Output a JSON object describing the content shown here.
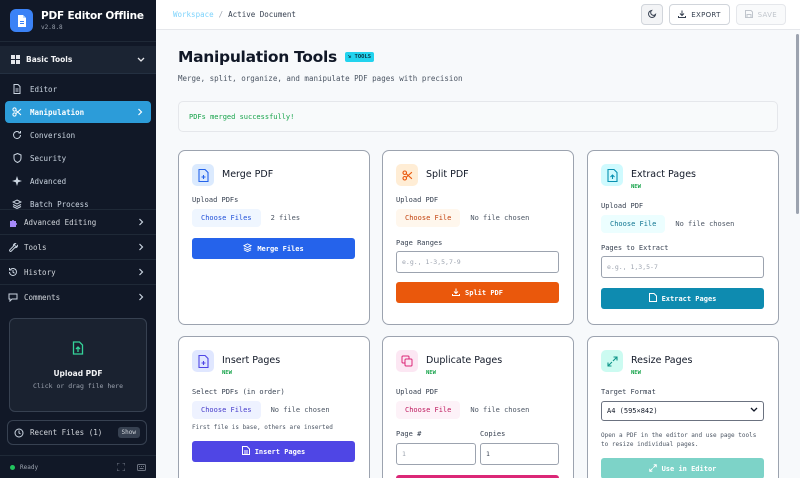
{
  "app": {
    "title": "PDF Editor Offline",
    "version": "v2.8.8"
  },
  "sidebar": {
    "section_title": "Basic Tools",
    "items": [
      {
        "label": "Editor",
        "icon": "document-icon"
      },
      {
        "label": "Manipulation",
        "icon": "scissors-icon",
        "active": true
      },
      {
        "label": "Conversion",
        "icon": "refresh-icon"
      },
      {
        "label": "Security",
        "icon": "shield-icon"
      },
      {
        "label": "Advanced",
        "icon": "sparkle-icon"
      },
      {
        "label": "Batch Process",
        "icon": "layers-icon"
      }
    ],
    "groups": [
      {
        "label": "Advanced Editing",
        "icon": "puzzle-icon"
      },
      {
        "label": "Tools",
        "icon": "wrench-icon"
      },
      {
        "label": "History",
        "icon": "history-icon"
      },
      {
        "label": "Comments",
        "icon": "comment-icon"
      }
    ],
    "upload": {
      "title": "Upload PDF",
      "subtitle": "Click or drag file here"
    },
    "recent": {
      "label": "Recent Files (1)",
      "show": "Show"
    },
    "status": "Ready"
  },
  "topbar": {
    "breadcrumb_root": "Workspace",
    "breadcrumb_sep": "/",
    "breadcrumb_current": "Active Document",
    "export_label": "EXPORT",
    "save_label": "SAVE"
  },
  "main": {
    "title": "Manipulation Tools",
    "badge": "TOOLS",
    "subtitle": "Merge, split, organize, and manipulate PDF pages with precision",
    "success_message": "PDFs merged successfully!"
  },
  "cards": {
    "merge": {
      "title": "Merge PDF",
      "upload_label": "Upload PDFs",
      "choose": "Choose Files",
      "file_status": "2 files",
      "button": "Merge Files"
    },
    "split": {
      "title": "Split PDF",
      "upload_label": "Upload PDF",
      "choose": "Choose File",
      "file_status": "No file chosen",
      "ranges_label": "Page Ranges",
      "ranges_placeholder": "e.g., 1-3,5,7-9",
      "button": "Split PDF"
    },
    "extract": {
      "title": "Extract Pages",
      "new": "NEW",
      "upload_label": "Upload PDF",
      "choose": "Choose File",
      "file_status": "No file chosen",
      "pages_label": "Pages to Extract",
      "pages_placeholder": "e.g., 1,3,5-7",
      "button": "Extract Pages"
    },
    "insert": {
      "title": "Insert Pages",
      "new": "NEW",
      "upload_label": "Select PDFs (in order)",
      "choose": "Choose Files",
      "file_status": "No file chosen",
      "hint": "First file is base, others are inserted",
      "button": "Insert Pages"
    },
    "duplicate": {
      "title": "Duplicate Pages",
      "new": "NEW",
      "upload_label": "Upload PDF",
      "choose": "Choose File",
      "file_status": "No file chosen",
      "page_label": "Page #",
      "page_placeholder": "1",
      "copies_label": "Copies",
      "copies_value": "1"
    },
    "resize": {
      "title": "Resize Pages",
      "new": "NEW",
      "format_label": "Target Format",
      "format_value": "A4 (595×842)",
      "hint": "Open a PDF in the editor and use page tools to resize individual pages.",
      "button": "Use in Editor"
    }
  },
  "colors": {
    "sidebar_bg": "#111827",
    "active_item": "#2c9cd9",
    "merge_button": "#2563eb",
    "split_button": "#ea580c",
    "extract_button": "#0e8bb0",
    "insert_button": "#4f46e5",
    "duplicate_button": "#db2777",
    "resize_button": "#7dd3c8",
    "success_text": "#16a34a",
    "badge_bg": "#22d3ee"
  }
}
